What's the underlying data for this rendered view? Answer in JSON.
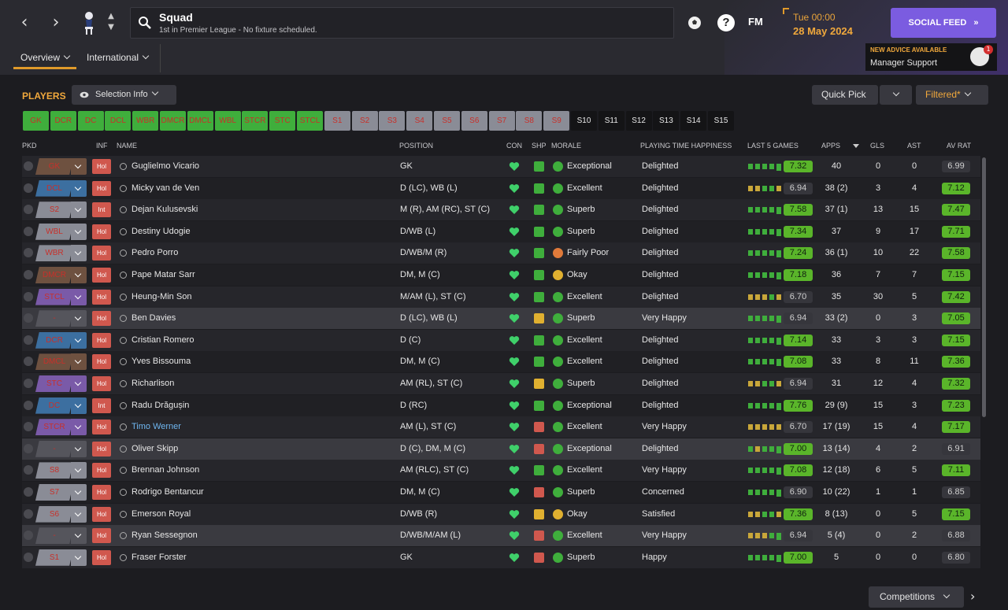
{
  "header": {
    "title": "Squad",
    "subtitle": "1st in Premier League - No fixture scheduled.",
    "time": "Tue 00:00",
    "date": "28 May 2024",
    "social_feed": "SOCIAL FEED",
    "fm_logo": "FM",
    "advice_title": "NEW ADVICE AVAILABLE",
    "advice_sub": "Manager Support",
    "advice_count": "1"
  },
  "tabs": {
    "overview": "Overview",
    "international": "International"
  },
  "toolbar": {
    "players_label": "PLAYERS",
    "selection_info": "Selection Info",
    "quick_pick": "Quick Pick",
    "filtered": "Filtered*"
  },
  "chips": [
    {
      "label": "GK",
      "style": "green"
    },
    {
      "label": "DCR",
      "style": "green"
    },
    {
      "label": "DC",
      "style": "green"
    },
    {
      "label": "DCL",
      "style": "green"
    },
    {
      "label": "WBR",
      "style": "green"
    },
    {
      "label": "DMCR",
      "style": "green"
    },
    {
      "label": "DMCL",
      "style": "green"
    },
    {
      "label": "WBL",
      "style": "green"
    },
    {
      "label": "STCR",
      "style": "green"
    },
    {
      "label": "STC",
      "style": "green"
    },
    {
      "label": "STCL",
      "style": "green"
    },
    {
      "label": "S1",
      "style": "grey"
    },
    {
      "label": "S2",
      "style": "grey"
    },
    {
      "label": "S3",
      "style": "grey"
    },
    {
      "label": "S4",
      "style": "grey"
    },
    {
      "label": "S5",
      "style": "grey"
    },
    {
      "label": "S6",
      "style": "grey"
    },
    {
      "label": "S7",
      "style": "grey"
    },
    {
      "label": "S8",
      "style": "grey"
    },
    {
      "label": "S9",
      "style": "grey"
    },
    {
      "label": "S10",
      "style": "dark"
    },
    {
      "label": "S11",
      "style": "dark"
    },
    {
      "label": "S12",
      "style": "dark"
    },
    {
      "label": "S13",
      "style": "dark"
    },
    {
      "label": "S14",
      "style": "dark"
    },
    {
      "label": "S15",
      "style": "dark"
    }
  ],
  "columns": {
    "pkd": "PKD",
    "inf": "INF",
    "name": "NAME",
    "position": "POSITION",
    "con": "CON",
    "shp": "SHP",
    "morale": "MORALE",
    "happiness": "PLAYING TIME HAPPINESS",
    "last5": "LAST 5 GAMES",
    "apps": "APPS",
    "gls": "GLS",
    "ast": "AST",
    "avrat": "AV RAT"
  },
  "players": [
    {
      "pkd": "GK",
      "pkd_color": "#6e5140",
      "inf": "Hol",
      "name": "Guglielmo Vicario",
      "position": "GK",
      "shp": "green",
      "morale": "Exceptional",
      "morale_color": "#3fae3c",
      "happiness": "Delighted",
      "form": [
        "g",
        "g",
        "g",
        "g",
        "g"
      ],
      "form_rating": "7.32",
      "form_high": true,
      "apps": "40",
      "gls": "0",
      "ast": "0",
      "avrat": "6.99",
      "avrat_high": false
    },
    {
      "pkd": "DCL",
      "pkd_color": "#3c6fa0",
      "inf": "Hol",
      "name": "Micky van de Ven",
      "position": "D (LC), WB (L)",
      "shp": "green",
      "morale": "Excellent",
      "morale_color": "#3fae3c",
      "happiness": "Delighted",
      "form": [
        "y",
        "y",
        "g",
        "g",
        "y"
      ],
      "form_rating": "6.94",
      "form_high": false,
      "apps": "38 (2)",
      "gls": "3",
      "ast": "4",
      "avrat": "7.12",
      "avrat_high": true
    },
    {
      "pkd": "S2",
      "pkd_color": "#8a8c96",
      "inf": "Int",
      "name": "Dejan Kulusevski",
      "position": "M (R), AM (RC), ST (C)",
      "shp": "green",
      "morale": "Superb",
      "morale_color": "#3fae3c",
      "happiness": "Delighted",
      "form": [
        "g",
        "g",
        "g",
        "g",
        "g"
      ],
      "form_rating": "7.58",
      "form_high": true,
      "apps": "37 (1)",
      "gls": "13",
      "ast": "15",
      "avrat": "7.47",
      "avrat_high": true
    },
    {
      "pkd": "WBL",
      "pkd_color": "#8a8c96",
      "inf": "Hol",
      "name": "Destiny Udogie",
      "position": "D/WB (L)",
      "shp": "green",
      "morale": "Superb",
      "morale_color": "#3fae3c",
      "happiness": "Delighted",
      "form": [
        "g",
        "g",
        "g",
        "g",
        "g"
      ],
      "form_rating": "7.34",
      "form_high": true,
      "apps": "37",
      "gls": "9",
      "ast": "17",
      "avrat": "7.71",
      "avrat_high": true
    },
    {
      "pkd": "WBR",
      "pkd_color": "#8a8c96",
      "inf": "Hol",
      "name": "Pedro Porro",
      "position": "D/WB/M (R)",
      "shp": "green",
      "morale": "Fairly Poor",
      "morale_color": "#e07a3a",
      "happiness": "Delighted",
      "form": [
        "g",
        "g",
        "g",
        "g",
        "g"
      ],
      "form_rating": "7.24",
      "form_high": true,
      "apps": "36 (1)",
      "gls": "10",
      "ast": "22",
      "avrat": "7.58",
      "avrat_high": true
    },
    {
      "pkd": "DMCR",
      "pkd_color": "#6e5140",
      "inf": "Hol",
      "name": "Pape Matar Sarr",
      "position": "DM, M (C)",
      "shp": "green",
      "morale": "Okay",
      "morale_color": "#e0b030",
      "happiness": "Delighted",
      "form": [
        "g",
        "g",
        "g",
        "g",
        "g"
      ],
      "form_rating": "7.18",
      "form_high": true,
      "apps": "36",
      "gls": "7",
      "ast": "7",
      "avrat": "7.15",
      "avrat_high": true
    },
    {
      "pkd": "STCL",
      "pkd_color": "#7a5aa8",
      "inf": "Hol",
      "name": "Heung-Min Son",
      "position": "M/AM (L), ST (C)",
      "shp": "green",
      "morale": "Excellent",
      "morale_color": "#3fae3c",
      "happiness": "Delighted",
      "form": [
        "y",
        "y",
        "y",
        "g",
        "y"
      ],
      "form_rating": "6.70",
      "form_high": false,
      "apps": "35",
      "gls": "30",
      "ast": "5",
      "avrat": "7.42",
      "avrat_high": true
    },
    {
      "pkd": "-",
      "pkd_color": "#55555c",
      "inf": "Hol",
      "name": "Ben Davies",
      "position": "D (LC), WB (L)",
      "shp": "yellow",
      "morale": "Superb",
      "morale_color": "#3fae3c",
      "happiness": "Very Happy",
      "form": [
        "g",
        "g",
        "g",
        "g",
        "g"
      ],
      "form_rating": "6.94",
      "form_high": false,
      "apps": "33 (2)",
      "gls": "0",
      "ast": "3",
      "avrat": "7.05",
      "avrat_high": true,
      "highlight": true
    },
    {
      "pkd": "DCR",
      "pkd_color": "#3c6fa0",
      "inf": "Hol",
      "name": "Cristian Romero",
      "position": "D (C)",
      "shp": "green",
      "morale": "Excellent",
      "morale_color": "#3fae3c",
      "happiness": "Delighted",
      "form": [
        "g",
        "g",
        "g",
        "g",
        "g"
      ],
      "form_rating": "7.14",
      "form_high": true,
      "apps": "33",
      "gls": "3",
      "ast": "3",
      "avrat": "7.15",
      "avrat_high": true
    },
    {
      "pkd": "DMCL",
      "pkd_color": "#6e5140",
      "inf": "Hol",
      "name": "Yves Bissouma",
      "position": "DM, M (C)",
      "shp": "green",
      "morale": "Excellent",
      "morale_color": "#3fae3c",
      "happiness": "Delighted",
      "form": [
        "g",
        "g",
        "g",
        "g",
        "g"
      ],
      "form_rating": "7.08",
      "form_high": true,
      "apps": "33",
      "gls": "8",
      "ast": "11",
      "avrat": "7.36",
      "avrat_high": true
    },
    {
      "pkd": "STC",
      "pkd_color": "#7a5aa8",
      "inf": "Hol",
      "name": "Richarlison",
      "position": "AM (RL), ST (C)",
      "shp": "yellow",
      "morale": "Superb",
      "morale_color": "#3fae3c",
      "happiness": "Delighted",
      "form": [
        "y",
        "y",
        "g",
        "g",
        "y"
      ],
      "form_rating": "6.94",
      "form_high": false,
      "apps": "31",
      "gls": "12",
      "ast": "4",
      "avrat": "7.32",
      "avrat_high": true
    },
    {
      "pkd": "DC",
      "pkd_color": "#3c6fa0",
      "inf": "Int",
      "name": "Radu Drăgușin",
      "position": "D (RC)",
      "shp": "green",
      "morale": "Exceptional",
      "morale_color": "#3fae3c",
      "happiness": "Delighted",
      "form": [
        "g",
        "g",
        "g",
        "g",
        "g"
      ],
      "form_rating": "7.76",
      "form_high": true,
      "apps": "29 (9)",
      "gls": "15",
      "ast": "3",
      "avrat": "7.23",
      "avrat_high": true
    },
    {
      "pkd": "STCR",
      "pkd_color": "#7a5aa8",
      "inf": "Hol",
      "name": "Timo Werner",
      "name_link": true,
      "position": "AM (L), ST (C)",
      "shp": "red",
      "morale": "Excellent",
      "morale_color": "#3fae3c",
      "happiness": "Very Happy",
      "form": [
        "y",
        "y",
        "y",
        "y",
        "y"
      ],
      "form_rating": "6.70",
      "form_high": false,
      "apps": "17 (19)",
      "gls": "15",
      "ast": "4",
      "avrat": "7.17",
      "avrat_high": true
    },
    {
      "pkd": "-",
      "pkd_color": "#55555c",
      "inf": "Hol",
      "name": "Oliver Skipp",
      "position": "D (C), DM, M (C)",
      "shp": "red",
      "morale": "Exceptional",
      "morale_color": "#3fae3c",
      "happiness": "Delighted",
      "form": [
        "g",
        "y",
        "g",
        "g",
        "g"
      ],
      "form_rating": "7.00",
      "form_high": true,
      "apps": "13 (14)",
      "gls": "4",
      "ast": "2",
      "avrat": "6.91",
      "avrat_high": false,
      "highlight": true
    },
    {
      "pkd": "S8",
      "pkd_color": "#8a8c96",
      "inf": "Hol",
      "name": "Brennan Johnson",
      "position": "AM (RLC), ST (C)",
      "shp": "green",
      "morale": "Excellent",
      "morale_color": "#3fae3c",
      "happiness": "Very Happy",
      "form": [
        "g",
        "g",
        "g",
        "g",
        "g"
      ],
      "form_rating": "7.08",
      "form_high": true,
      "apps": "12 (18)",
      "gls": "6",
      "ast": "5",
      "avrat": "7.11",
      "avrat_high": true
    },
    {
      "pkd": "S7",
      "pkd_color": "#8a8c96",
      "inf": "Hol",
      "name": "Rodrigo Bentancur",
      "position": "DM, M (C)",
      "shp": "red",
      "morale": "Superb",
      "morale_color": "#3fae3c",
      "happiness": "Concerned",
      "form": [
        "g",
        "g",
        "g",
        "g",
        "g"
      ],
      "form_rating": "6.90",
      "form_high": false,
      "apps": "10 (22)",
      "gls": "1",
      "ast": "1",
      "avrat": "6.85",
      "avrat_high": false
    },
    {
      "pkd": "S6",
      "pkd_color": "#8a8c96",
      "inf": "Hol",
      "name": "Emerson Royal",
      "position": "D/WB (R)",
      "shp": "yellow",
      "morale": "Okay",
      "morale_color": "#e0b030",
      "happiness": "Satisfied",
      "form": [
        "y",
        "y",
        "g",
        "g",
        "y"
      ],
      "form_rating": "7.36",
      "form_high": true,
      "apps": "8 (13)",
      "gls": "0",
      "ast": "5",
      "avrat": "7.15",
      "avrat_high": true
    },
    {
      "pkd": "-",
      "pkd_color": "#55555c",
      "inf": "Hol",
      "name": "Ryan Sessegnon",
      "position": "D/WB/M/AM (L)",
      "shp": "red",
      "morale": "Excellent",
      "morale_color": "#3fae3c",
      "happiness": "Very Happy",
      "form": [
        "y",
        "y",
        "y",
        "g",
        "g"
      ],
      "form_rating": "6.94",
      "form_high": false,
      "apps": "5 (4)",
      "gls": "0",
      "ast": "2",
      "avrat": "6.88",
      "avrat_high": false,
      "highlight": true
    },
    {
      "pkd": "S1",
      "pkd_color": "#8a8c96",
      "inf": "Hol",
      "name": "Fraser Forster",
      "position": "GK",
      "shp": "red",
      "morale": "Superb",
      "morale_color": "#3fae3c",
      "happiness": "Happy",
      "form": [
        "g",
        "g",
        "g",
        "g",
        "g"
      ],
      "form_rating": "7.00",
      "form_high": true,
      "apps": "5",
      "gls": "0",
      "ast": "0",
      "avrat": "6.80",
      "avrat_high": false
    }
  ],
  "footer": {
    "competitions": "Competitions"
  }
}
